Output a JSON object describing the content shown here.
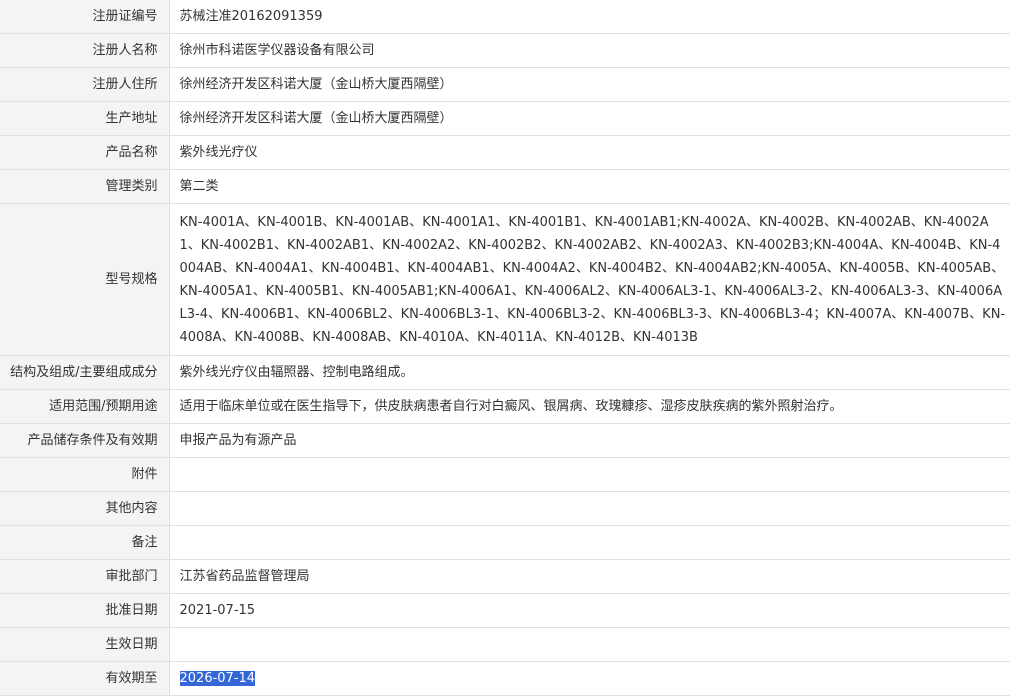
{
  "fields": [
    {
      "label": "注册证编号",
      "value": "苏械注准20162091359"
    },
    {
      "label": "注册人名称",
      "value": "徐州市科诺医学仪器设备有限公司"
    },
    {
      "label": "注册人住所",
      "value": "徐州经济开发区科诺大厦（金山桥大厦西隔壁）"
    },
    {
      "label": "生产地址",
      "value": "徐州经济开发区科诺大厦（金山桥大厦西隔壁）"
    },
    {
      "label": "产品名称",
      "value": "紫外线光疗仪"
    },
    {
      "label": "管理类别",
      "value": "第二类"
    },
    {
      "label": "型号规格",
      "value": "KN-4001A、KN-4001B、KN-4001AB、KN-4001A1、KN-4001B1、KN-4001AB1;KN-4002A、KN-4002B、KN-4002AB、KN-4002A1、KN-4002B1、KN-4002AB1、KN-4002A2、KN-4002B2、KN-4002AB2、KN-4002A3、KN-4002B3;KN-4004A、KN-4004B、KN-4004AB、KN-4004A1、KN-4004B1、KN-4004AB1、KN-4004A2、KN-4004B2、KN-4004AB2;KN-4005A、KN-4005B、KN-4005AB、KN-4005A1、KN-4005B1、KN-4005AB1;KN-4006A1、KN-4006AL2、KN-4006AL3-1、KN-4006AL3-2、KN-4006AL3-3、KN-4006AL3-4、KN-4006B1、KN-4006BL2、KN-4006BL3-1、KN-4006BL3-2、KN-4006BL3-3、KN-4006BL3-4；KN-4007A、KN-4007B、KN-4008A、KN-4008B、KN-4008AB、KN-4010A、KN-4011A、KN-4012B、KN-4013B"
    },
    {
      "label": "结构及组成/主要组成成分",
      "value": "紫外线光疗仪由辐照器、控制电路组成。"
    },
    {
      "label": "适用范围/预期用途",
      "value": "适用于临床单位或在医生指导下，供皮肤病患者自行对白癜风、银屑病、玫瑰糠疹、湿疹皮肤疾病的紫外照射治疗。"
    },
    {
      "label": "产品储存条件及有效期",
      "value": "申报产品为有源产品"
    },
    {
      "label": "附件",
      "value": ""
    },
    {
      "label": "其他内容",
      "value": ""
    },
    {
      "label": "备注",
      "value": ""
    },
    {
      "label": "审批部门",
      "value": "江苏省药品监督管理局"
    },
    {
      "label": "批准日期",
      "value": "2021-07-15"
    },
    {
      "label": "生效日期",
      "value": ""
    },
    {
      "label": "有效期至",
      "value": "2026-07-14"
    }
  ]
}
